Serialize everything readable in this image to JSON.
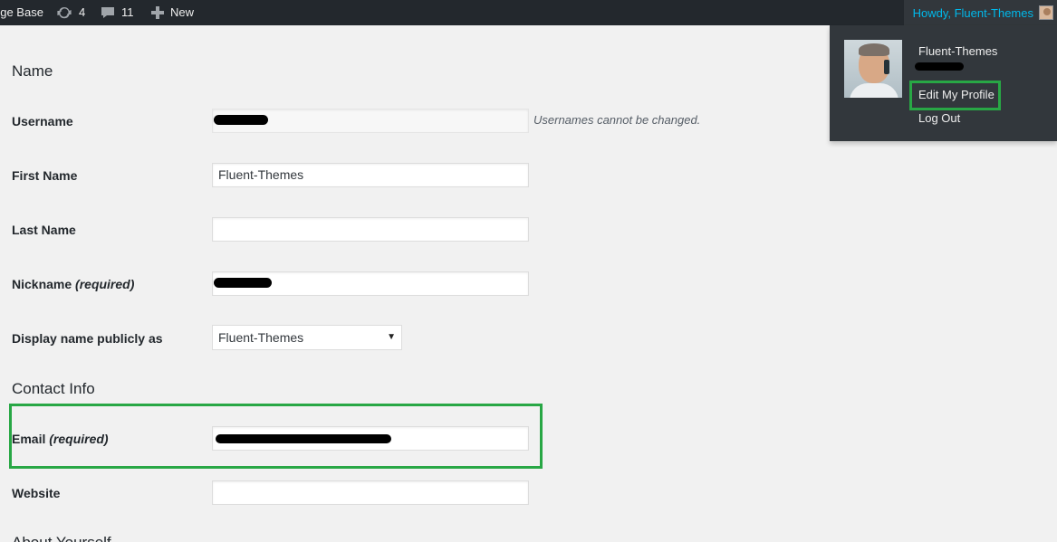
{
  "adminbar": {
    "site_title": "dge Base",
    "updates_count": "4",
    "comments_count": "11",
    "new_label": "New",
    "howdy": "Howdy, Fluent-Themes"
  },
  "account_menu": {
    "display_name": "Fluent-Themes",
    "edit_profile": "Edit My Profile",
    "log_out": "Log Out"
  },
  "form": {
    "name_heading": "Name",
    "username_label": "Username",
    "username_note": "Usernames cannot be changed.",
    "first_name_label": "First Name",
    "first_name_value": "Fluent-Themes",
    "last_name_label": "Last Name",
    "last_name_value": "",
    "nickname_label": "Nickname",
    "nickname_required": "(required)",
    "display_name_label": "Display name publicly as",
    "display_name_value": "Fluent-Themes",
    "contact_heading": "Contact Info",
    "email_label": "Email",
    "email_required": "(required)",
    "website_label": "Website",
    "website_value": "",
    "about_heading": "About Yourself"
  },
  "colors": {
    "adminbar_bg": "#23282d",
    "howdy_link": "#00b9eb",
    "highlight_box": "#28a745",
    "page_bg": "#f1f1f1"
  },
  "icons": [
    "updates-icon",
    "comments-icon",
    "plus-icon",
    "dropdown-arrow-icon"
  ]
}
